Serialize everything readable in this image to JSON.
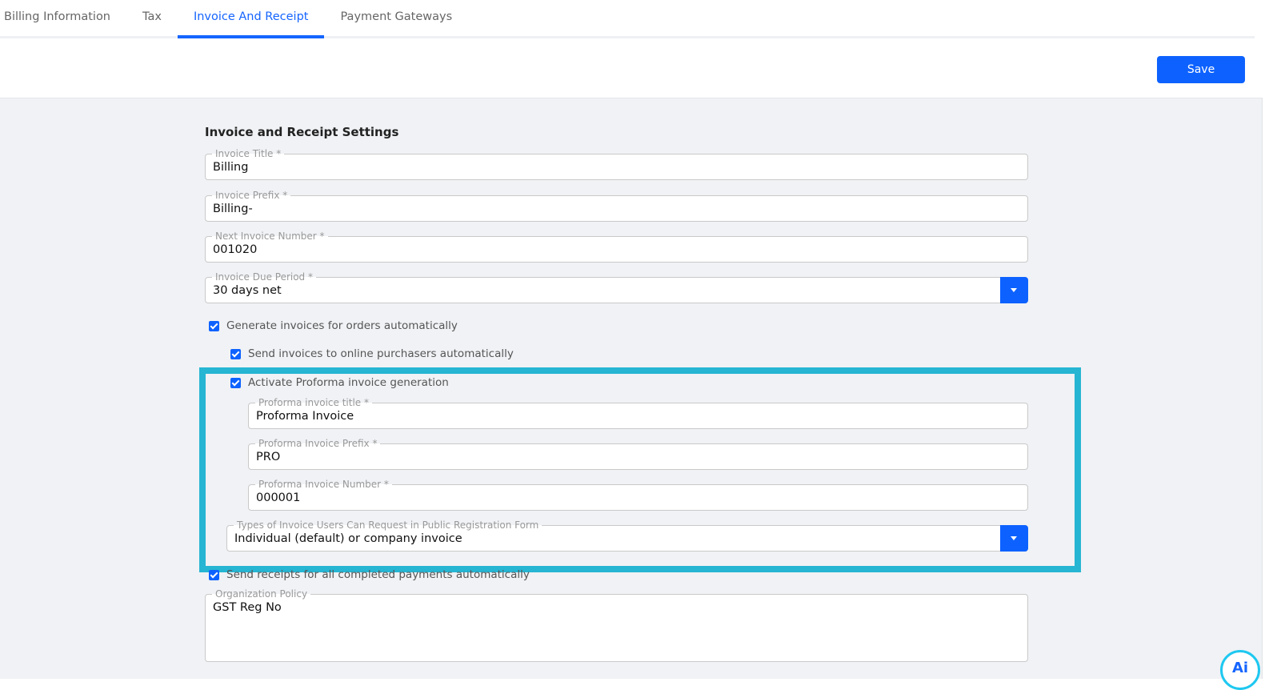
{
  "tabs": [
    "Billing Information",
    "Tax",
    "Invoice And Receipt",
    "Payment Gateways"
  ],
  "save_label": "Save",
  "heading": "Invoice and Receipt Settings",
  "fields": {
    "invoice_title": {
      "label": "Invoice Title *",
      "value": "Billing"
    },
    "invoice_prefix": {
      "label": "Invoice Prefix *",
      "value": "Billing-"
    },
    "next_number": {
      "label": "Next Invoice Number *",
      "value": "001020"
    },
    "due_period": {
      "label": "Invoice Due Period *",
      "value": "30 days net"
    },
    "proforma_title": {
      "label": "Proforma invoice title *",
      "value": "Proforma Invoice"
    },
    "proforma_prefix": {
      "label": "Proforma Invoice Prefix *",
      "value": "PRO"
    },
    "proforma_number": {
      "label": "Proforma Invoice Number *",
      "value": "000001"
    },
    "invoice_types": {
      "label": "Types of Invoice Users Can Request in Public Registration Form",
      "value": "Individual (default) or company invoice"
    },
    "org_policy": {
      "label": "Organization Policy",
      "value": "GST Reg No"
    }
  },
  "checks": {
    "generate": "Generate invoices for orders automatically",
    "send_online": "Send invoices to online purchasers automatically",
    "proforma": "Activate Proforma invoice generation",
    "receipts": "Send receipts for all completed payments automatically"
  },
  "ai_badge": "Ai",
  "colors": {
    "accent": "#0d62ff",
    "highlight": "#26b5d3"
  }
}
